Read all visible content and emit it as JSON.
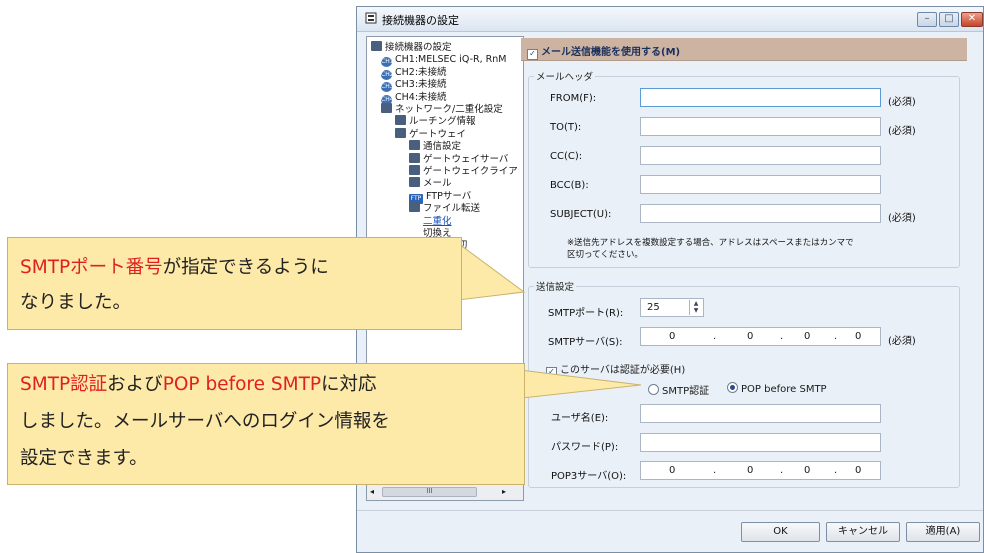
{
  "window": {
    "title": "接続機器の設定",
    "min_label": "–",
    "max_label": "□",
    "close_label": "✕"
  },
  "tree": {
    "items": [
      {
        "label": "接続機器の設定",
        "icon": "connection-settings-icon"
      },
      {
        "label": "CH1:MELSEC iQ-R, RnM",
        "icon": "ch1-icon"
      },
      {
        "label": "CH2:未接続",
        "icon": "ch2-icon"
      },
      {
        "label": "CH3:未接続",
        "icon": "ch3-icon"
      },
      {
        "label": "CH4:未接続",
        "icon": "ch4-icon"
      },
      {
        "label": "ネットワーク/二重化設定",
        "icon": "network-icon"
      },
      {
        "label": "ルーチング情報",
        "icon": "routing-icon"
      },
      {
        "label": "ゲートウェイ",
        "icon": "gateway-icon"
      },
      {
        "label": "通信設定",
        "icon": "comm-settings-icon"
      },
      {
        "label": "ゲートウェイサーバ",
        "icon": "gateway-server-icon"
      },
      {
        "label": "ゲートウェイクライア",
        "icon": "gateway-client-icon"
      },
      {
        "label": "メール",
        "icon": "mail-icon"
      },
      {
        "label": "FTPサーバ",
        "icon": "ftp-icon"
      },
      {
        "label": "ファイル転送",
        "icon": "file-transfer-icon"
      },
      {
        "label": "二重化",
        "icon": "redundancy-icon"
      },
      {
        "label": "切換え",
        "icon": "switch-icon"
      },
      {
        "label": "ットNo.切",
        "icon": "network-no-icon"
      }
    ],
    "scroll_thumb_label": "III"
  },
  "mail": {
    "enable_label": "メール送信機能を使用する(M)",
    "enable_checked": true,
    "header_group": "メールヘッダ",
    "from_label": "FROM(F):",
    "to_label": "TO(T):",
    "cc_label": "CC(C):",
    "bcc_label": "BCC(B):",
    "subject_label": "SUBJECT(U):",
    "required": "(必須)",
    "note_line1": "※送信先アドレスを複数設定する場合、アドレスはスペースまたはカンマで",
    "note_line2": "区切ってください。"
  },
  "send": {
    "group": "送信設定",
    "port_label": "SMTPポート(R):",
    "port_value": "25",
    "server_label": "SMTPサーバ(S):",
    "ip": [
      "0",
      "0",
      "0",
      "0"
    ],
    "dot": ".",
    "auth_label": "このサーバは認証が必要(H)",
    "auth_checked": true,
    "smtp_auth_label": "SMTP認証",
    "pop_label": "POP before SMTP",
    "user_label": "ユーザ名(E):",
    "password_label": "パスワード(P):",
    "pop3_label": "POP3サーバ(O):"
  },
  "buttons": {
    "ok": "OK",
    "cancel": "キャンセル",
    "apply": "適用(A)"
  },
  "callouts": {
    "c1_red": "SMTPポート番号",
    "c1_rest": "が指定できるように",
    "c1_line2": "なりました。",
    "c2_red1": "SMTP認証",
    "c2_mid": "および",
    "c2_red2": "POP before SMTP",
    "c2_rest": "に対応",
    "c2_line2": "しました。メールサーバへのログイン情報を",
    "c2_line3": "設定できます。",
    "accent_color": "#e02020",
    "fill_color": "#fde9a8"
  }
}
